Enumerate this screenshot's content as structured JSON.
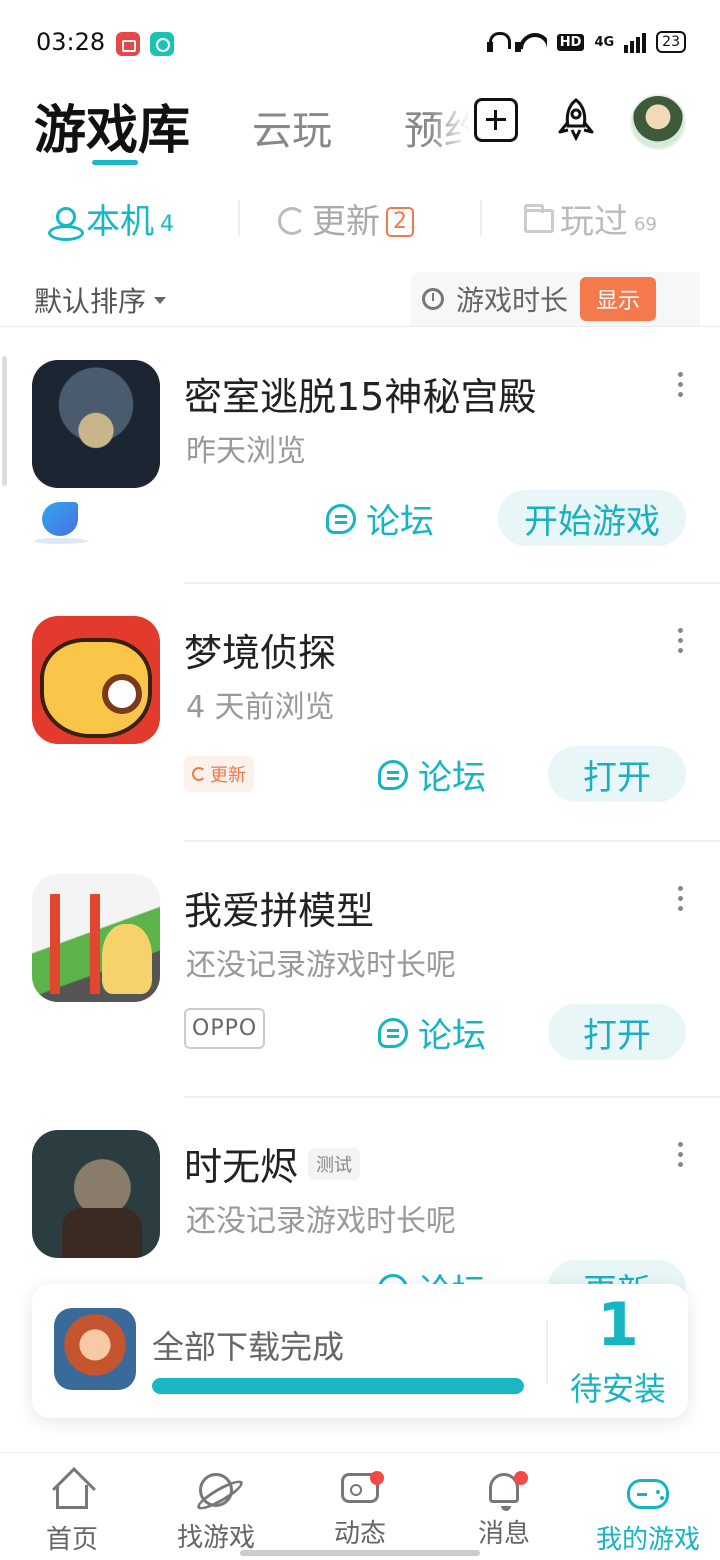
{
  "status_bar": {
    "time": "03:28",
    "hd": "HD",
    "network": "4G",
    "battery": "23"
  },
  "header": {
    "tabs": [
      {
        "label": "游戏库",
        "active": true
      },
      {
        "label": "云玩",
        "active": false
      },
      {
        "label": "预约",
        "active": false
      }
    ],
    "icons": [
      "add-icon",
      "rocket-icon",
      "avatar"
    ]
  },
  "sub_tabs": [
    {
      "label": "本机",
      "count": "4",
      "icon": "location-icon",
      "active": true
    },
    {
      "label": "更新",
      "badge": "2",
      "icon": "refresh-icon",
      "active": false
    },
    {
      "label": "玩过",
      "count": "69",
      "icon": "folder-icon",
      "active": false
    }
  ],
  "sort": {
    "label": "默认排序",
    "playtime_label": "游戏时长",
    "playtime_toggle": "显示"
  },
  "games": [
    {
      "title": "密室逃脱15神秘宫殿",
      "subtitle": "昨天浏览",
      "forum": "论坛",
      "action": "开始游戏"
    },
    {
      "title": "梦境侦探",
      "subtitle": "4 天前浏览",
      "tag": "更新",
      "forum": "论坛",
      "action": "打开"
    },
    {
      "title": "我爱拼模型",
      "subtitle": "还没记录游戏时长呢",
      "tag": "OPPO",
      "forum": "论坛",
      "action": "打开"
    },
    {
      "title": "时无烬",
      "title_tag": "测试",
      "subtitle": "还没记录游戏时长呢",
      "forum": "论坛",
      "action": "更新"
    }
  ],
  "download_card": {
    "status": "全部下载完成",
    "progress": 1.0,
    "count": "1",
    "count_label": "待安装"
  },
  "bottom_nav": [
    {
      "label": "首页",
      "icon": "home-icon",
      "active": false
    },
    {
      "label": "找游戏",
      "icon": "planet-icon",
      "active": false
    },
    {
      "label": "动态",
      "icon": "chat-icon",
      "active": false,
      "dot": true
    },
    {
      "label": "消息",
      "icon": "bell-icon",
      "active": false,
      "dot": true
    },
    {
      "label": "我的游戏",
      "icon": "gamepad-icon",
      "active": true
    }
  ],
  "colors": {
    "accent": "#17b4c4",
    "orange": "#f47a4e",
    "red_dot": "#f04a4a"
  }
}
